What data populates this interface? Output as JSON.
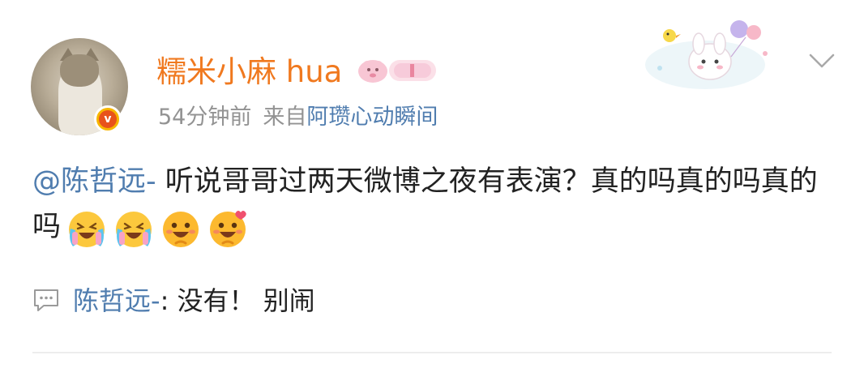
{
  "post": {
    "username": "糯米小麻 hua",
    "time": "54分钟前",
    "from_prefix": "来自",
    "source": "阿瓒心动瞬间",
    "mention": "@陈哲远-",
    "text_line": " 听说哥哥过两天微博之夜有表演？真的吗真的吗真的吗",
    "emojis": [
      "laugh-cry-emoji",
      "laugh-cry-emoji",
      "happy-emoji",
      "happy-emoji"
    ]
  },
  "comment": {
    "user": "陈哲远-",
    "separator": ": ",
    "text": "没有！ 别闹"
  },
  "colors": {
    "username": "#f0791f",
    "link": "#507daf",
    "meta": "#939393",
    "verified": "#f7b500"
  }
}
